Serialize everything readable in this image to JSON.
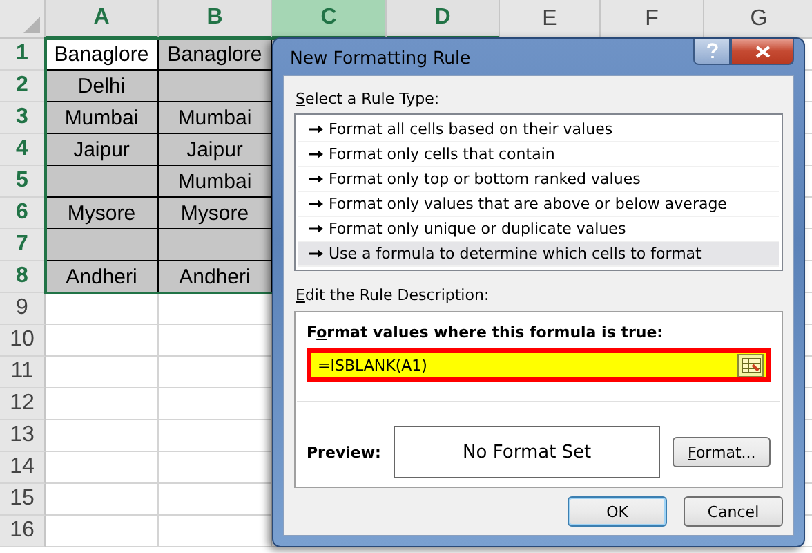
{
  "sheet": {
    "columns": [
      {
        "label": "A",
        "selected": true,
        "active": false
      },
      {
        "label": "B",
        "selected": true,
        "active": false
      },
      {
        "label": "C",
        "selected": true,
        "active": true
      },
      {
        "label": "D",
        "selected": true,
        "active": false
      },
      {
        "label": "E",
        "selected": false,
        "active": false
      },
      {
        "label": "F",
        "selected": false,
        "active": false
      },
      {
        "label": "G",
        "selected": false,
        "active": false
      }
    ],
    "rows": [
      {
        "label": "1",
        "selected": true,
        "cells": [
          {
            "text": "Banaglore",
            "active": true
          },
          {
            "text": "Banaglore",
            "active": false
          }
        ]
      },
      {
        "label": "2",
        "selected": true,
        "cells": [
          {
            "text": "Delhi",
            "active": false
          },
          {
            "text": "",
            "active": false
          }
        ]
      },
      {
        "label": "3",
        "selected": true,
        "cells": [
          {
            "text": "Mumbai",
            "active": false
          },
          {
            "text": "Mumbai",
            "active": false
          }
        ]
      },
      {
        "label": "4",
        "selected": true,
        "cells": [
          {
            "text": "Jaipur",
            "active": false
          },
          {
            "text": "Jaipur",
            "active": false
          }
        ]
      },
      {
        "label": "5",
        "selected": true,
        "cells": [
          {
            "text": "",
            "active": false
          },
          {
            "text": "Mumbai",
            "active": false
          }
        ]
      },
      {
        "label": "6",
        "selected": true,
        "cells": [
          {
            "text": "Mysore",
            "active": false
          },
          {
            "text": "Mysore",
            "active": false
          }
        ]
      },
      {
        "label": "7",
        "selected": true,
        "cells": [
          {
            "text": "",
            "active": false
          },
          {
            "text": "",
            "active": false
          }
        ]
      },
      {
        "label": "8",
        "selected": true,
        "cells": [
          {
            "text": "Andheri",
            "active": false
          },
          {
            "text": "Andheri",
            "active": false
          }
        ]
      },
      {
        "label": "9",
        "selected": false
      },
      {
        "label": "10",
        "selected": false
      },
      {
        "label": "11",
        "selected": false
      },
      {
        "label": "12",
        "selected": false
      },
      {
        "label": "13",
        "selected": false
      },
      {
        "label": "14",
        "selected": false
      },
      {
        "label": "15",
        "selected": false
      },
      {
        "label": "16",
        "selected": false
      }
    ]
  },
  "dialog": {
    "title": "New Formatting Rule",
    "rule_type_label": {
      "access_key": "S",
      "rest": "elect a Rule Type:"
    },
    "rule_types": [
      {
        "label": "Format all cells based on their values",
        "selected": false
      },
      {
        "label": "Format only cells that contain",
        "selected": false
      },
      {
        "label": "Format only top or bottom ranked values",
        "selected": false
      },
      {
        "label": "Format only values that are above or below average",
        "selected": false
      },
      {
        "label": "Format only unique or duplicate values",
        "selected": false
      },
      {
        "label": "Use a formula to determine which cells to format",
        "selected": true
      }
    ],
    "description_label": {
      "access_key": "E",
      "rest": "dit the Rule Description:"
    },
    "formula_label": {
      "lead": "F",
      "access_key": "o",
      "rest": "rmat values where this formula is true:"
    },
    "formula": {
      "value": "=ISBLANK(A1)",
      "highlighted": true
    },
    "preview_label": "Preview:",
    "preview_text": "No Format Set",
    "format_button": {
      "access_key": "F",
      "rest": "ormat..."
    },
    "buttons": [
      {
        "label": "OK",
        "default": true
      },
      {
        "label": "Cancel",
        "default": false
      }
    ]
  }
}
